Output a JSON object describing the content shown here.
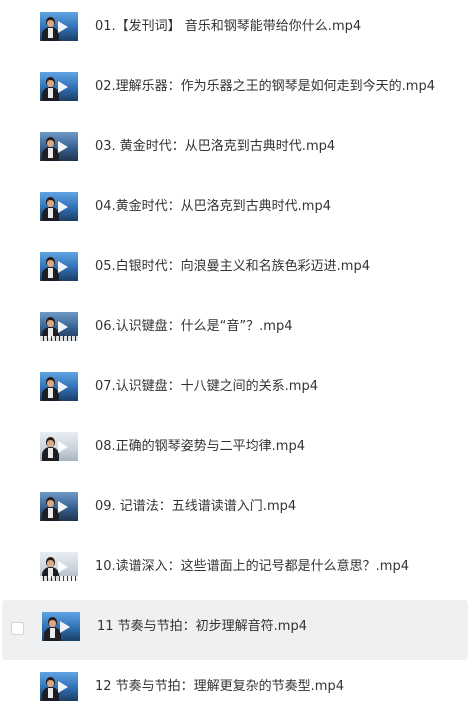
{
  "files": [
    {
      "name": "01.【发刊词】 音乐和钢琴能带给你什么.mp4",
      "thumb_icon": "video-thumbnail-icon"
    },
    {
      "name": "02.理解乐器：作为乐器之王的钢琴是如何走到今天的.mp4",
      "thumb_icon": "video-thumbnail-icon"
    },
    {
      "name": "03. 黄金时代：从巴洛克到古典时代.mp4",
      "thumb_icon": "video-thumbnail-icon"
    },
    {
      "name": "04.黄金时代：从巴洛克到古典时代.mp4",
      "thumb_icon": "video-thumbnail-icon"
    },
    {
      "name": "05.白银时代：向浪曼主义和名族色彩迈进.mp4",
      "thumb_icon": "video-thumbnail-icon"
    },
    {
      "name": "06.认识键盘：什么是“音”？.mp4",
      "thumb_icon": "video-thumbnail-icon"
    },
    {
      "name": "07.认识键盘：十八键之间的关系.mp4",
      "thumb_icon": "video-thumbnail-icon"
    },
    {
      "name": "08.正确的钢琴姿势与二平均律.mp4",
      "thumb_icon": "video-thumbnail-icon"
    },
    {
      "name": "09. 记谱法：五线谱读谱入门.mp4",
      "thumb_icon": "video-thumbnail-icon"
    },
    {
      "name": "10.读谱深入：这些谱面上的记号都是什么意思？.mp4",
      "thumb_icon": "video-thumbnail-icon"
    },
    {
      "name": "11 节奏与节拍：初步理解音符.mp4",
      "thumb_icon": "video-thumbnail-icon",
      "selected": true
    },
    {
      "name": "12 节奏与节拍：理解更复杂的节奏型.mp4",
      "thumb_icon": "video-thumbnail-icon"
    }
  ],
  "colors": {
    "text": "#333333",
    "selected_row_bg": "#eff0f1",
    "background": "#ffffff"
  }
}
